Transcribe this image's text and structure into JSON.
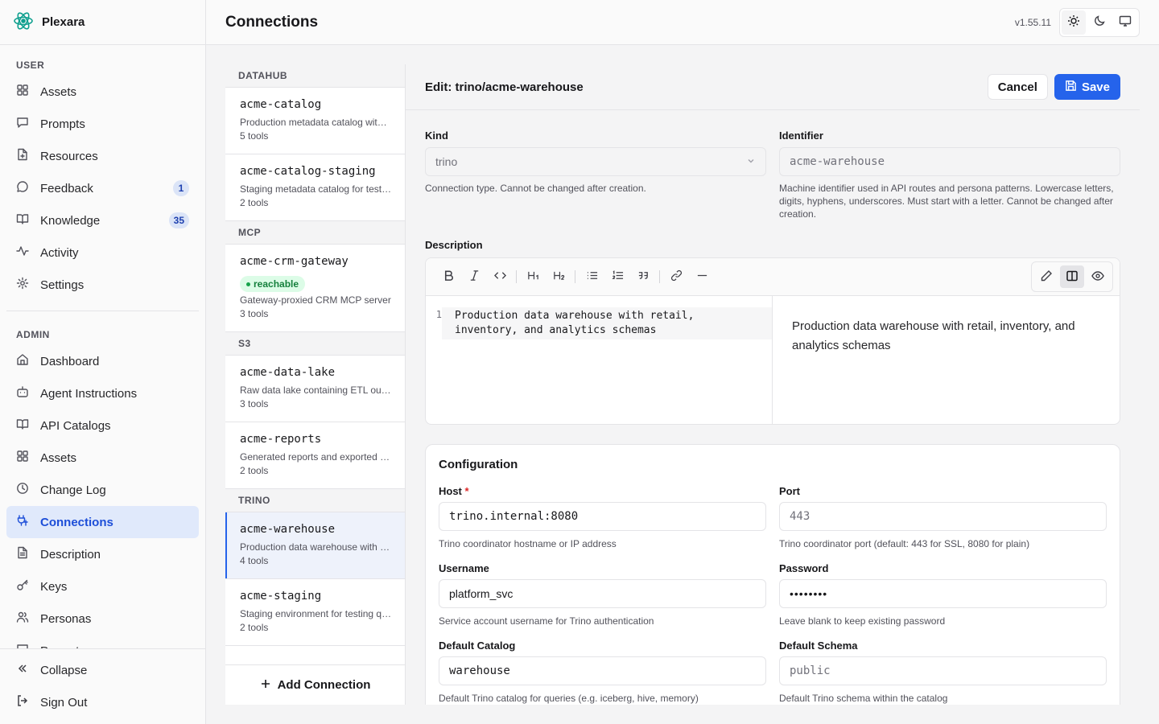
{
  "app": {
    "name": "Plexara",
    "version": "v1.55.11",
    "page_title": "Connections"
  },
  "sidebar": {
    "user_label": "USER",
    "user_items": [
      {
        "label": "Assets",
        "icon": "grid-icon"
      },
      {
        "label": "Prompts",
        "icon": "chat-icon"
      },
      {
        "label": "Resources",
        "icon": "file-plus-icon"
      },
      {
        "label": "Feedback",
        "icon": "message-circle-icon",
        "badge": "1"
      },
      {
        "label": "Knowledge",
        "icon": "book-open-icon",
        "badge": "35"
      },
      {
        "label": "Activity",
        "icon": "activity-icon"
      },
      {
        "label": "Settings",
        "icon": "gear-icon"
      }
    ],
    "admin_label": "ADMIN",
    "admin_items": [
      {
        "label": "Dashboard",
        "icon": "home-icon"
      },
      {
        "label": "Agent Instructions",
        "icon": "bot-icon"
      },
      {
        "label": "API Catalogs",
        "icon": "book-open-icon"
      },
      {
        "label": "Assets",
        "icon": "grid-icon"
      },
      {
        "label": "Change Log",
        "icon": "clock-icon"
      },
      {
        "label": "Connections",
        "icon": "plug-icon",
        "active": true
      },
      {
        "label": "Description",
        "icon": "file-text-icon"
      },
      {
        "label": "Keys",
        "icon": "key-icon"
      },
      {
        "label": "Personas",
        "icon": "users-icon"
      },
      {
        "label": "Prompts",
        "icon": "chat-icon"
      }
    ],
    "collapse_label": "Collapse",
    "signout_label": "Sign Out"
  },
  "connections": {
    "groups": [
      {
        "label": "DATAHUB",
        "items": [
          {
            "name": "acme-catalog",
            "desc": "Production metadata catalog with business context",
            "tools": "5 tools"
          },
          {
            "name": "acme-catalog-staging",
            "desc": "Staging metadata catalog for testing",
            "tools": "2 tools"
          }
        ]
      },
      {
        "label": "MCP",
        "items": [
          {
            "name": "acme-crm-gateway",
            "badge": "reachable",
            "desc": "Gateway-proxied CRM MCP server",
            "tools": "3 tools"
          }
        ]
      },
      {
        "label": "S3",
        "items": [
          {
            "name": "acme-data-lake",
            "desc": "Raw data lake containing ETL outputs",
            "tools": "3 tools"
          },
          {
            "name": "acme-reports",
            "desc": "Generated reports and exported dashboards",
            "tools": "2 tools"
          }
        ]
      },
      {
        "label": "TRINO",
        "items": [
          {
            "name": "acme-warehouse",
            "desc": "Production data warehouse with retail, inventory, and analytics schemas",
            "tools": "4 tools",
            "active": true
          },
          {
            "name": "acme-staging",
            "desc": "Staging environment for testing queries",
            "tools": "2 tools"
          }
        ]
      }
    ],
    "add_label": "Add Connection"
  },
  "editor": {
    "title": "Edit: trino/acme-warehouse",
    "cancel_label": "Cancel",
    "save_label": "Save",
    "kind": {
      "label": "Kind",
      "value": "trino",
      "help": "Connection type. Cannot be changed after creation."
    },
    "identifier": {
      "label": "Identifier",
      "value": "acme-warehouse",
      "help": "Machine identifier used in API routes and persona patterns. Lowercase letters, digits, hyphens, underscores. Must start with a letter. Cannot be changed after creation."
    },
    "description": {
      "label": "Description",
      "line_number": "1",
      "source": "Production data warehouse with retail,\ninventory, and analytics schemas",
      "preview": "Production data warehouse with retail, inventory, and analytics schemas"
    },
    "config": {
      "title": "Configuration",
      "host": {
        "label": "Host",
        "required": "*",
        "value": "trino.internal:8080",
        "help": "Trino coordinator hostname or IP address"
      },
      "port": {
        "label": "Port",
        "placeholder": "443",
        "help": "Trino coordinator port (default: 443 for SSL, 8080 for plain)"
      },
      "username": {
        "label": "Username",
        "value": "platform_svc",
        "help": "Service account username for Trino authentication"
      },
      "password": {
        "label": "Password",
        "value": "••••••••",
        "help": "Leave blank to keep existing password"
      },
      "default_catalog": {
        "label": "Default Catalog",
        "value": "warehouse",
        "help": "Default Trino catalog for queries (e.g. iceberg, hive, memory)"
      },
      "default_schema": {
        "label": "Default Schema",
        "placeholder": "public",
        "help": "Default Trino schema within the catalog"
      }
    }
  }
}
